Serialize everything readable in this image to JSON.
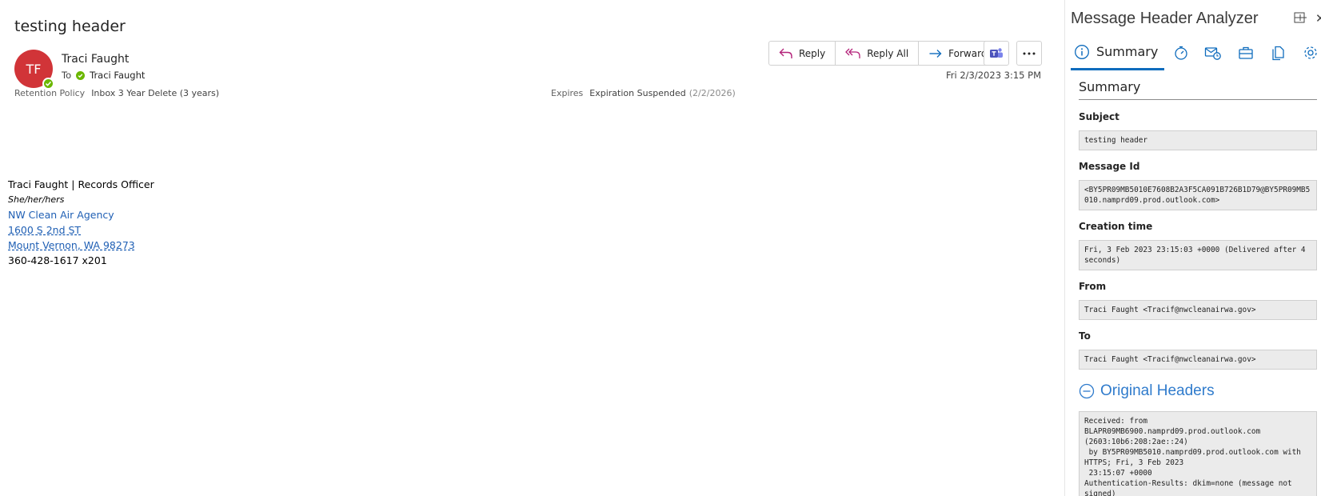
{
  "email": {
    "subject": "testing header",
    "avatar_initials": "TF",
    "sender": "Traci Faught",
    "to_label": "To",
    "to_name": "Traci Faught",
    "timestamp": "Fri 2/3/2023 3:15 PM",
    "retention_label": "Retention Policy",
    "retention_value": "Inbox 3 Year Delete (3 years)",
    "expires_label": "Expires",
    "expires_value": "Expiration Suspended",
    "expires_date": "(2/2/2026)",
    "actions": {
      "reply": "Reply",
      "reply_all": "Reply All",
      "forward": "Forward"
    },
    "signature": {
      "name_line": "Traci Faught | Records Officer",
      "pronouns": "She/her/hers",
      "agency": "NW Clean Air Agency",
      "street": "1600 S 2nd ST",
      "city": "Mount Vernon, WA 98273",
      "phone": "360-428-1617 x201"
    }
  },
  "addin": {
    "title": "Message Header Analyzer",
    "active_tab": "Summary",
    "section_title": "Summary",
    "fields": {
      "subject_label": "Subject",
      "subject_value": "testing header",
      "message_id_label": "Message Id",
      "message_id_value": "<BY5PR09MB5010E7608B2A3F5CA091B726B1D79@BY5PR09MB5010.namprd09.prod.outlook.com>",
      "creation_label": "Creation time",
      "creation_value": "Fri, 3 Feb 2023 23:15:03 +0000 (Delivered after 4 seconds)",
      "from_label": "From",
      "from_value": "Traci Faught <Tracif@nwcleanairwa.gov>",
      "to_label": "To",
      "to_value": "Traci Faught <Tracif@nwcleanairwa.gov>"
    },
    "original_headers_title": "Original Headers",
    "original_headers_text": "Received: from\nBLAPR09MB6900.namprd09.prod.outlook.com\n(2603:10b6:208:2ae::24)\n by BY5PR09MB5010.namprd09.prod.outlook.com with\nHTTPS; Fri, 3 Feb 2023\n 23:15:07 +0000\nAuthentication-Results: dkim=none (message not\nsigned)"
  },
  "colors": {
    "avatar": "#d13438",
    "presence": "#6bb700",
    "accent": "#0f6cbd",
    "link": "#1f5fb4"
  }
}
